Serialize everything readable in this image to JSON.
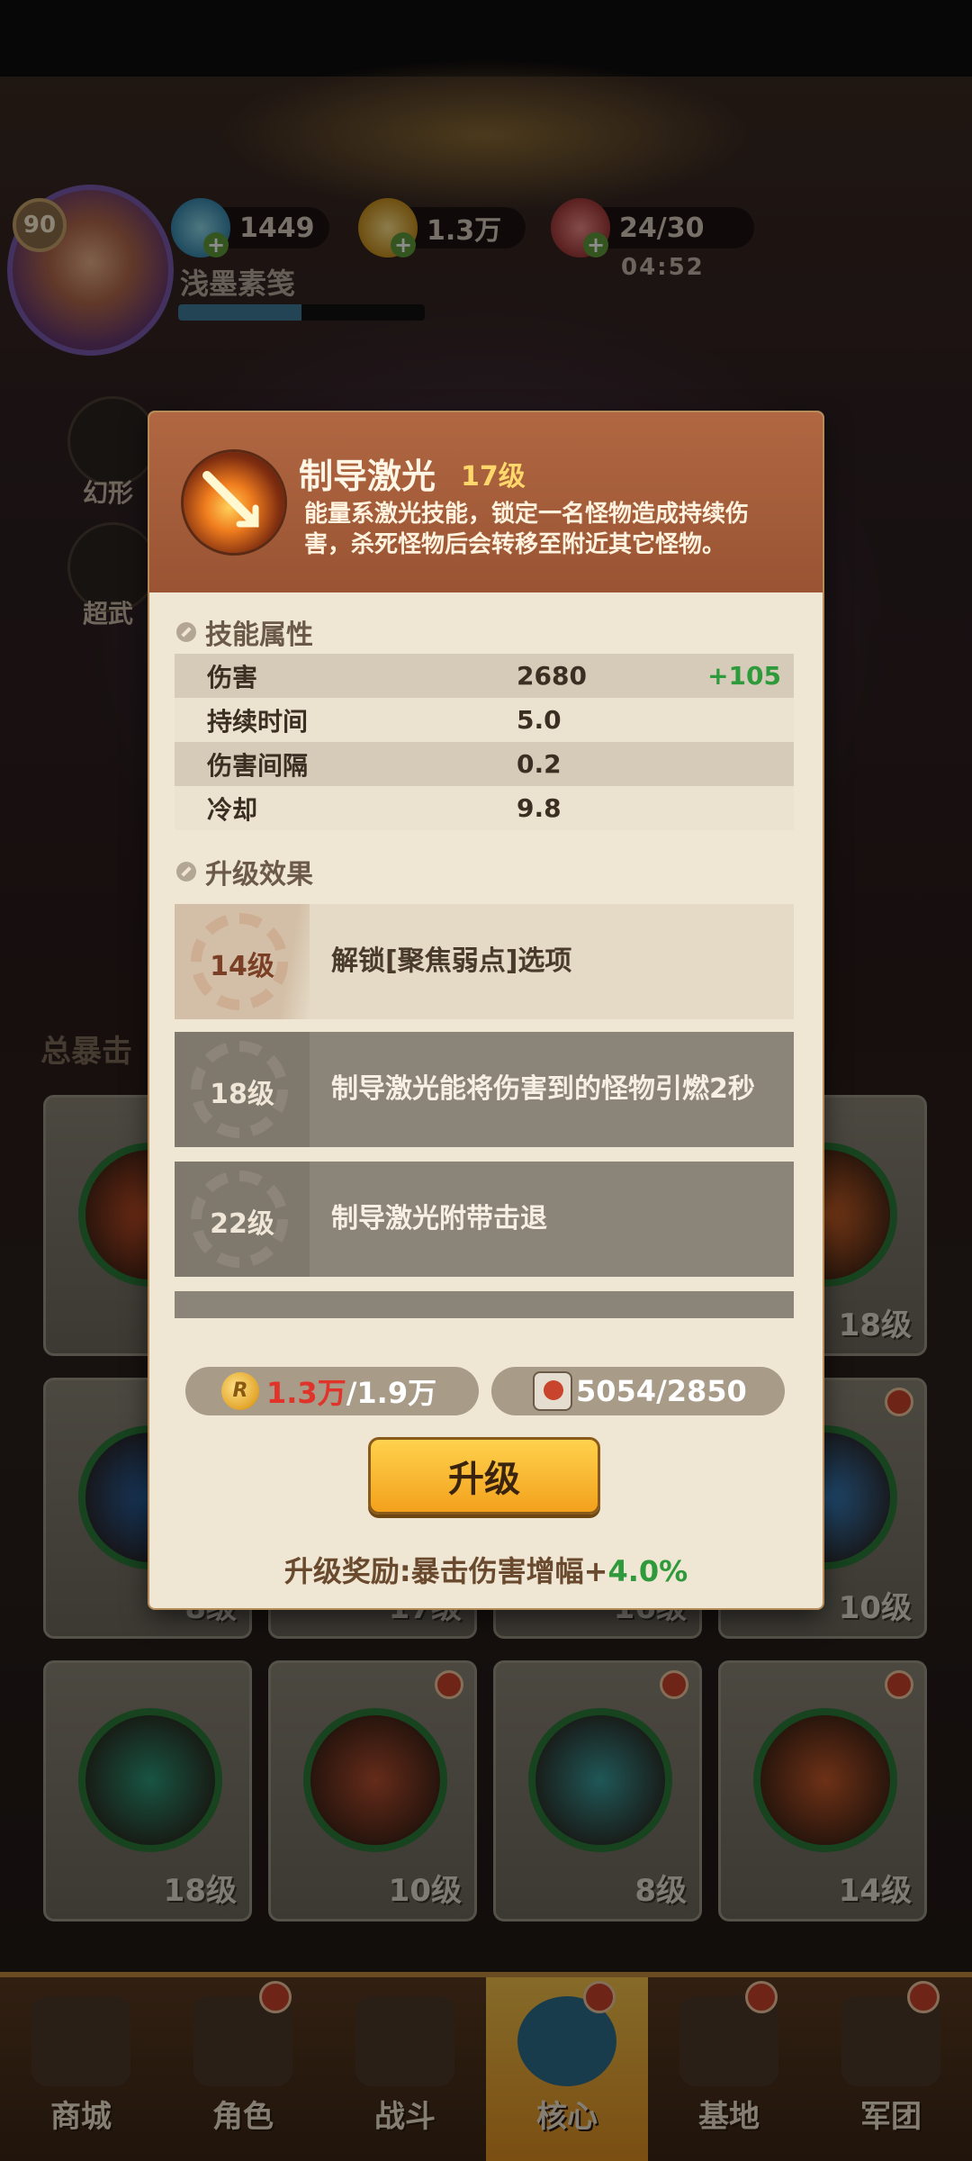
{
  "hud": {
    "player_level": "90",
    "player_name": "浅墨素笺",
    "xp_fraction": 0.5,
    "resources": [
      {
        "icon": "gem-icon",
        "value": "1449"
      },
      {
        "icon": "coin-icon",
        "value": "1.3万"
      },
      {
        "icon": "stamina-icon",
        "value": "24/30"
      }
    ],
    "timer": "04:52",
    "side_buttons": [
      {
        "icon": "fox-mask-icon",
        "label": "幻形"
      },
      {
        "icon": "weapon-icon",
        "label": "超武"
      }
    ],
    "section_title": "总暴击"
  },
  "background_cards": [
    {
      "level": "",
      "dot": false
    },
    {
      "level": "",
      "dot": false
    },
    {
      "level": "",
      "dot": false
    },
    {
      "level": "18级",
      "dot": false
    },
    {
      "level": "8级",
      "dot": false
    },
    {
      "level": "17级",
      "dot": false
    },
    {
      "level": "16级",
      "dot": false
    },
    {
      "level": "10级",
      "dot": true
    },
    {
      "level": "18级",
      "dot": false
    },
    {
      "level": "10级",
      "dot": true
    },
    {
      "level": "8级",
      "dot": true
    },
    {
      "level": "14级",
      "dot": true
    }
  ],
  "modal": {
    "skill_name": "制导激光",
    "skill_level": "17级",
    "skill_description": "能量系激光技能，锁定一名怪物造成持续伤害，杀死怪物后会转移至附近其它怪物。",
    "attributes_title": "技能属性",
    "attributes": [
      {
        "name": "伤害",
        "value": "2680",
        "bonus": "+105"
      },
      {
        "name": "持续时间",
        "value": "5.0",
        "bonus": ""
      },
      {
        "name": "伤害间隔",
        "value": "0.2",
        "bonus": ""
      },
      {
        "name": "冷却",
        "value": "9.8",
        "bonus": ""
      }
    ],
    "effects_title": "升级效果",
    "effects": [
      {
        "level": "14级",
        "text": "解锁[聚焦弱点]选项",
        "unlocked": true
      },
      {
        "level": "18级",
        "text": "制导激光能将伤害到的怪物引燃2秒",
        "unlocked": false
      },
      {
        "level": "22级",
        "text": "制导激光附带击退",
        "unlocked": false
      }
    ],
    "cost_coins_current": "1.3万",
    "cost_coins_required": "/1.9万",
    "cost_scrolls": "5054/2850",
    "upgrade_button": "升级",
    "reward_label": "升级奖励:暴击伤害增幅+",
    "reward_value": "4.0%"
  },
  "bottom_nav": [
    {
      "label": "商城",
      "icon": "shop-icon",
      "dot": false,
      "active": false
    },
    {
      "label": "角色",
      "icon": "character-icon",
      "dot": true,
      "active": false
    },
    {
      "label": "战斗",
      "icon": "battle-icon",
      "dot": false,
      "active": false
    },
    {
      "label": "核心",
      "icon": "core-icon",
      "dot": true,
      "active": true
    },
    {
      "label": "基地",
      "icon": "base-icon",
      "dot": true,
      "active": false
    },
    {
      "label": "军团",
      "icon": "legion-icon",
      "dot": true,
      "active": false
    }
  ]
}
